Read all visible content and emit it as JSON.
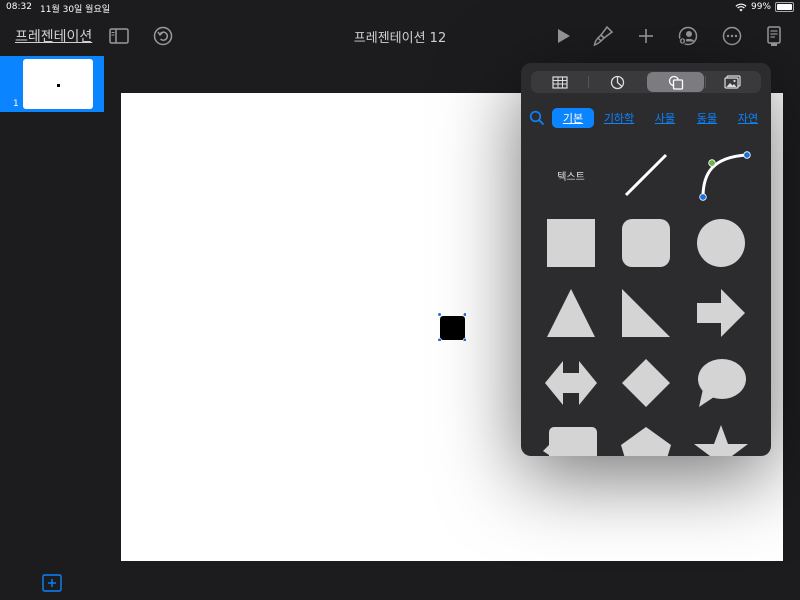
{
  "status": {
    "time": "08:32",
    "date": "11월 30일 월요일",
    "battery": "99%",
    "battery_level": 0.99
  },
  "toolbar": {
    "back_label": "프레젠테이션",
    "document_title": "프레젠테이션 12",
    "icons": [
      "sidebar-toggle-icon",
      "undo-icon",
      "play-icon",
      "paintbrush-icon",
      "plus-icon",
      "collaborate-icon",
      "more-icon",
      "presenter-notes-icon"
    ]
  },
  "sidebar": {
    "slides": [
      {
        "number": "1",
        "selected": true
      }
    ],
    "add_slide_icon": "add-slide-icon"
  },
  "popover": {
    "segments": [
      {
        "icon": "table-icon",
        "active": false
      },
      {
        "icon": "chart-icon",
        "active": false
      },
      {
        "icon": "shapes-icon",
        "active": true
      },
      {
        "icon": "media-icon",
        "active": false
      }
    ],
    "categories": [
      {
        "label": "기본",
        "active": true
      },
      {
        "label": "기하학",
        "active": false
      },
      {
        "label": "사물",
        "active": false
      },
      {
        "label": "동물",
        "active": false
      },
      {
        "label": "자연",
        "active": false
      }
    ],
    "shapes": {
      "text_label": "텍스트",
      "items": [
        "text",
        "line",
        "curve",
        "square",
        "rounded-square",
        "circle",
        "triangle",
        "right-triangle",
        "arrow",
        "double-arrow",
        "diamond",
        "speech-bubble",
        "callout",
        "pentagon",
        "star"
      ]
    }
  },
  "colors": {
    "accent": "#0a84ff",
    "shape_fill": "#d4d4d4",
    "popover_bg": "#2c2c2e",
    "app_bg": "#1c1c1e"
  }
}
